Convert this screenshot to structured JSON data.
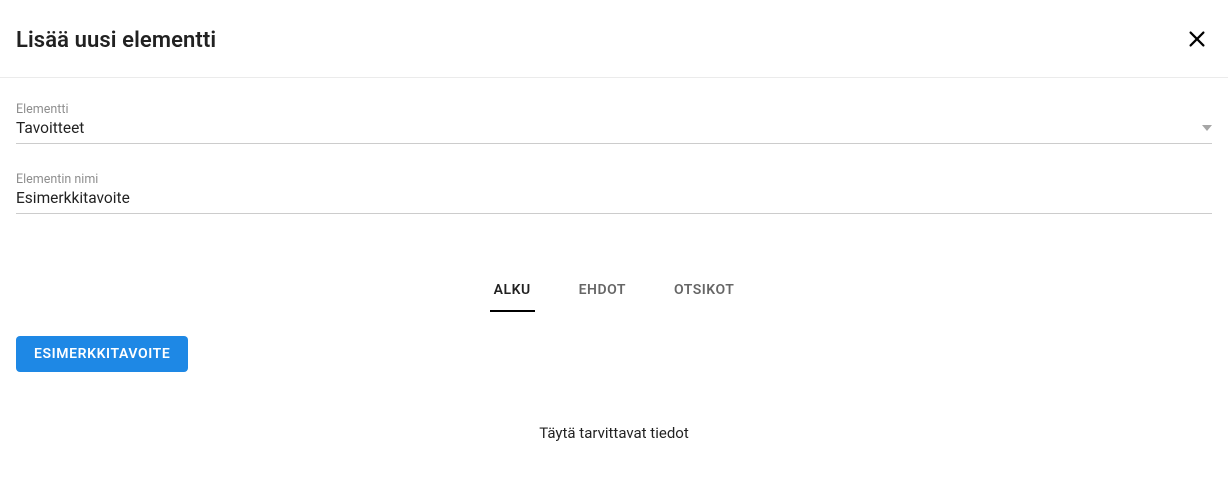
{
  "header": {
    "title": "Lisää uusi elementti"
  },
  "fields": {
    "element": {
      "label": "Elementti",
      "value": "Tavoitteet"
    },
    "elementName": {
      "label": "Elementin nimi",
      "value": "Esimerkkitavoite"
    }
  },
  "tabs": {
    "items": [
      {
        "label": "ALKU"
      },
      {
        "label": "EHDOT"
      },
      {
        "label": "OTSIKOT"
      }
    ],
    "activeIndex": 0
  },
  "chip": {
    "label": "ESIMERKKITAVOITE"
  },
  "helper": {
    "text": "Täytä tarvittavat tiedot"
  },
  "colors": {
    "primary": "#1e88e5"
  }
}
